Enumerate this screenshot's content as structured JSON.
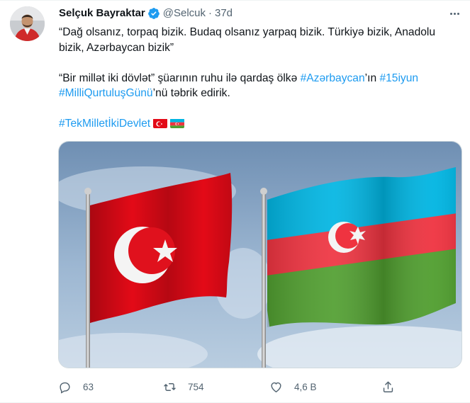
{
  "author": {
    "name": "Selçuk Bayraktar",
    "handle": "@Selcuk",
    "separator": "·",
    "time": "37d",
    "verified": true
  },
  "tweet": {
    "line1": "“Dağ olsanız, torpaq bizik. Budaq olsanız yarpaq bizik. Türkiyə bizik, Anadolu bizik, Azərbaycan bizik”",
    "line2_start": "“Bir millət iki dövlət” şüarının ruhu ilə qardaş ölkə ",
    "hashtag_azerbaycan": "#Azərbaycan",
    "line2_mid": "’ın ",
    "hashtag_15iyun": "#15iyun",
    "hashtag_milli": "#MilliQurtuluşGünü",
    "line2_end": "’nü təbrik edirik.",
    "hashtag_tek": "#TekMilletİkiDevlet",
    "emoji_flags": [
      "turkey-flag",
      "azerbaijan-flag"
    ]
  },
  "media": {
    "flags": [
      "turkey-flag",
      "azerbaijan-flag"
    ]
  },
  "actions": {
    "reply_count": "63",
    "retweet_count": "754",
    "like_count": "4,6 B"
  },
  "colors": {
    "link": "#1d9bf0",
    "secondary": "#536471",
    "verified": "#1d9bf0",
    "turkey_red": "#e30a17",
    "az_blue": "#00b5e2",
    "az_red": "#ef3340",
    "az_green": "#509e2f"
  }
}
